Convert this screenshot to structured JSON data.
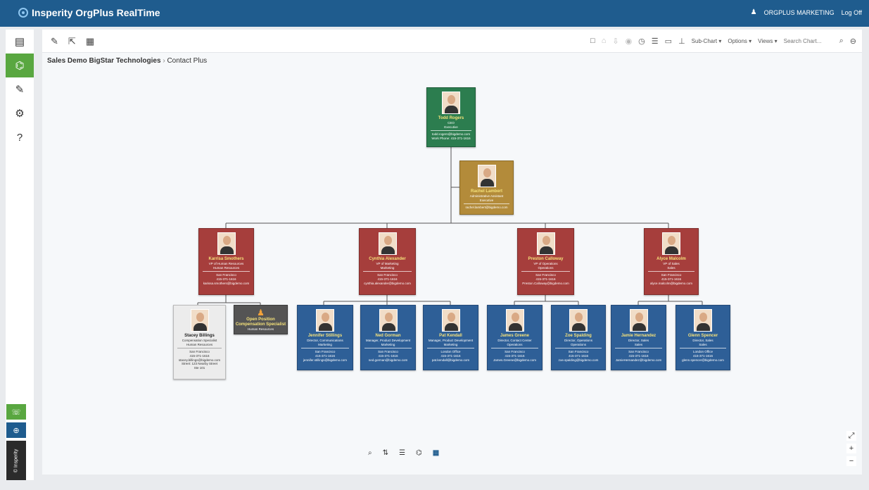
{
  "header": {
    "brand": "Insperity OrgPlus RealTime",
    "user": "ORGPLUS MARKETING",
    "logoff": "Log Off",
    "user_icon": "user-icon"
  },
  "sidebar": {
    "items": [
      {
        "icon": "card-icon",
        "glyph": "▤"
      },
      {
        "icon": "org-chart-icon",
        "glyph": "⌬"
      },
      {
        "icon": "edit-icon",
        "glyph": "✎"
      },
      {
        "icon": "settings-icon",
        "glyph": "⚙"
      },
      {
        "icon": "help-icon",
        "glyph": "?"
      }
    ],
    "footer": {
      "feedback_glyph": "☏",
      "blue_glyph": "⊕",
      "brand": "© Insperity"
    }
  },
  "toolbar": {
    "left_glyphs": [
      "✎",
      "⇱",
      "▦"
    ],
    "right_icons": [
      "□",
      "⌂",
      "⇩",
      "◉",
      "◷",
      "☰",
      "▭",
      "⊥"
    ],
    "subchart": "Sub-Chart ▾",
    "options": "Options ▾",
    "views": "Views ▾",
    "search_placeholder": "Search Chart...",
    "search_glyph": "⌕",
    "account_glyph": "⊖"
  },
  "breadcrumb": {
    "root": "Sales Demo BigStar Technologies",
    "separator": "›",
    "current": "Contact Plus"
  },
  "colors": {
    "green": "#2c7d4f",
    "gold": "#b38b3a",
    "red": "#a63e3c",
    "blue": "#2e5f97"
  },
  "org": {
    "ceo": {
      "name": "Todd Rogers",
      "title": "CEO",
      "dept": "Executive",
      "email": "todd.rogers@bigdemo.com",
      "phone": "Work Phone: 415-371-1616"
    },
    "assistant": {
      "name": "Rachel Lambert",
      "title": "Administrative Assistant",
      "dept": "Executive",
      "email": "rachel.lambert@bigdemo.com"
    },
    "vps": [
      {
        "name": "Karrisa Smothers",
        "title": "VP of Human Resources",
        "dept": "Human Resources",
        "location": "San Francisco",
        "phone": "415-371-1616",
        "email": "karissa.smothers@bigdemo.com"
      },
      {
        "name": "Cynthia Alexander",
        "title": "VP of Marketing",
        "dept": "Marketing",
        "location": "San Francisco",
        "phone": "415-371-1616",
        "email": "cynthia.alexander@bigdemo.com"
      },
      {
        "name": "Preston Calloway",
        "title": "VP of Operations",
        "dept": "Operations",
        "location": "San Francisco",
        "phone": "415-371-1616",
        "email": "Preston.Calloway@bigdemo.com"
      },
      {
        "name": "Alyce Malcolm",
        "title": "VP of Sales",
        "dept": "Sales",
        "location": "San Francisco",
        "phone": "415-371-1616",
        "email": "alyce.malcolm@bigdemo.com"
      }
    ],
    "stacey": {
      "name": "Stacey Billings",
      "title": "Compensation Specialist",
      "dept": "Human Resources",
      "location": "San Francisco",
      "phone": "415-371-1616",
      "email": "stacey.billings@bigdemo.com",
      "street": "Street: 123 Nearby Street",
      "suite": "Ste 101"
    },
    "open": {
      "label": "Open Position",
      "title": "Compensation Specialist",
      "dept": "Human Resources"
    },
    "staff": [
      {
        "name": "Jennifer Stillings",
        "title": "Director, Communications",
        "dept": "Marketing",
        "location": "San Francisco",
        "phone": "415-371-1616",
        "email": "jennifer.stillings@bigdemo.com"
      },
      {
        "name": "Ned Gorman",
        "title": "Manager, Product Development",
        "dept": "Marketing",
        "location": "San Francisco",
        "phone": "415-371-1616",
        "email": "ned.gorman@bigdemo.com"
      },
      {
        "name": "Pat Kendall",
        "title": "Manager, Product Development",
        "dept": "Marketing",
        "location": "London Office",
        "phone": "415-371-1616",
        "email": "pat.kendall@bigdemo.com"
      },
      {
        "name": "James Greene",
        "title": "Director, Contact Center",
        "dept": "Operations",
        "location": "San Francisco",
        "phone": "415-371-1616",
        "email": "James.Greene@bigdemo.com"
      },
      {
        "name": "Zoe Spalding",
        "title": "Director, Operations",
        "dept": "Operations",
        "location": "San Francisco",
        "phone": "415-371-1616",
        "email": "zoe.spalding@bigdemo.com"
      },
      {
        "name": "Jamie Hernandez",
        "title": "Director, Sales",
        "dept": "Sales",
        "location": "San Francisco",
        "phone": "415-371-1616",
        "email": "JamieHernandez@bigdemo.com"
      },
      {
        "name": "Glenn Spencer",
        "title": "Director, Sales",
        "dept": "Sales",
        "location": "London Office",
        "phone": "415-371-1616",
        "email": "glenn.spencer@bigdemo.com"
      }
    ]
  },
  "zoom": {
    "fit": "⤢",
    "plus": "+",
    "minus": "−"
  },
  "bottom_tools": [
    "⌕",
    "⇅",
    "☰",
    "⌬",
    "▦"
  ]
}
